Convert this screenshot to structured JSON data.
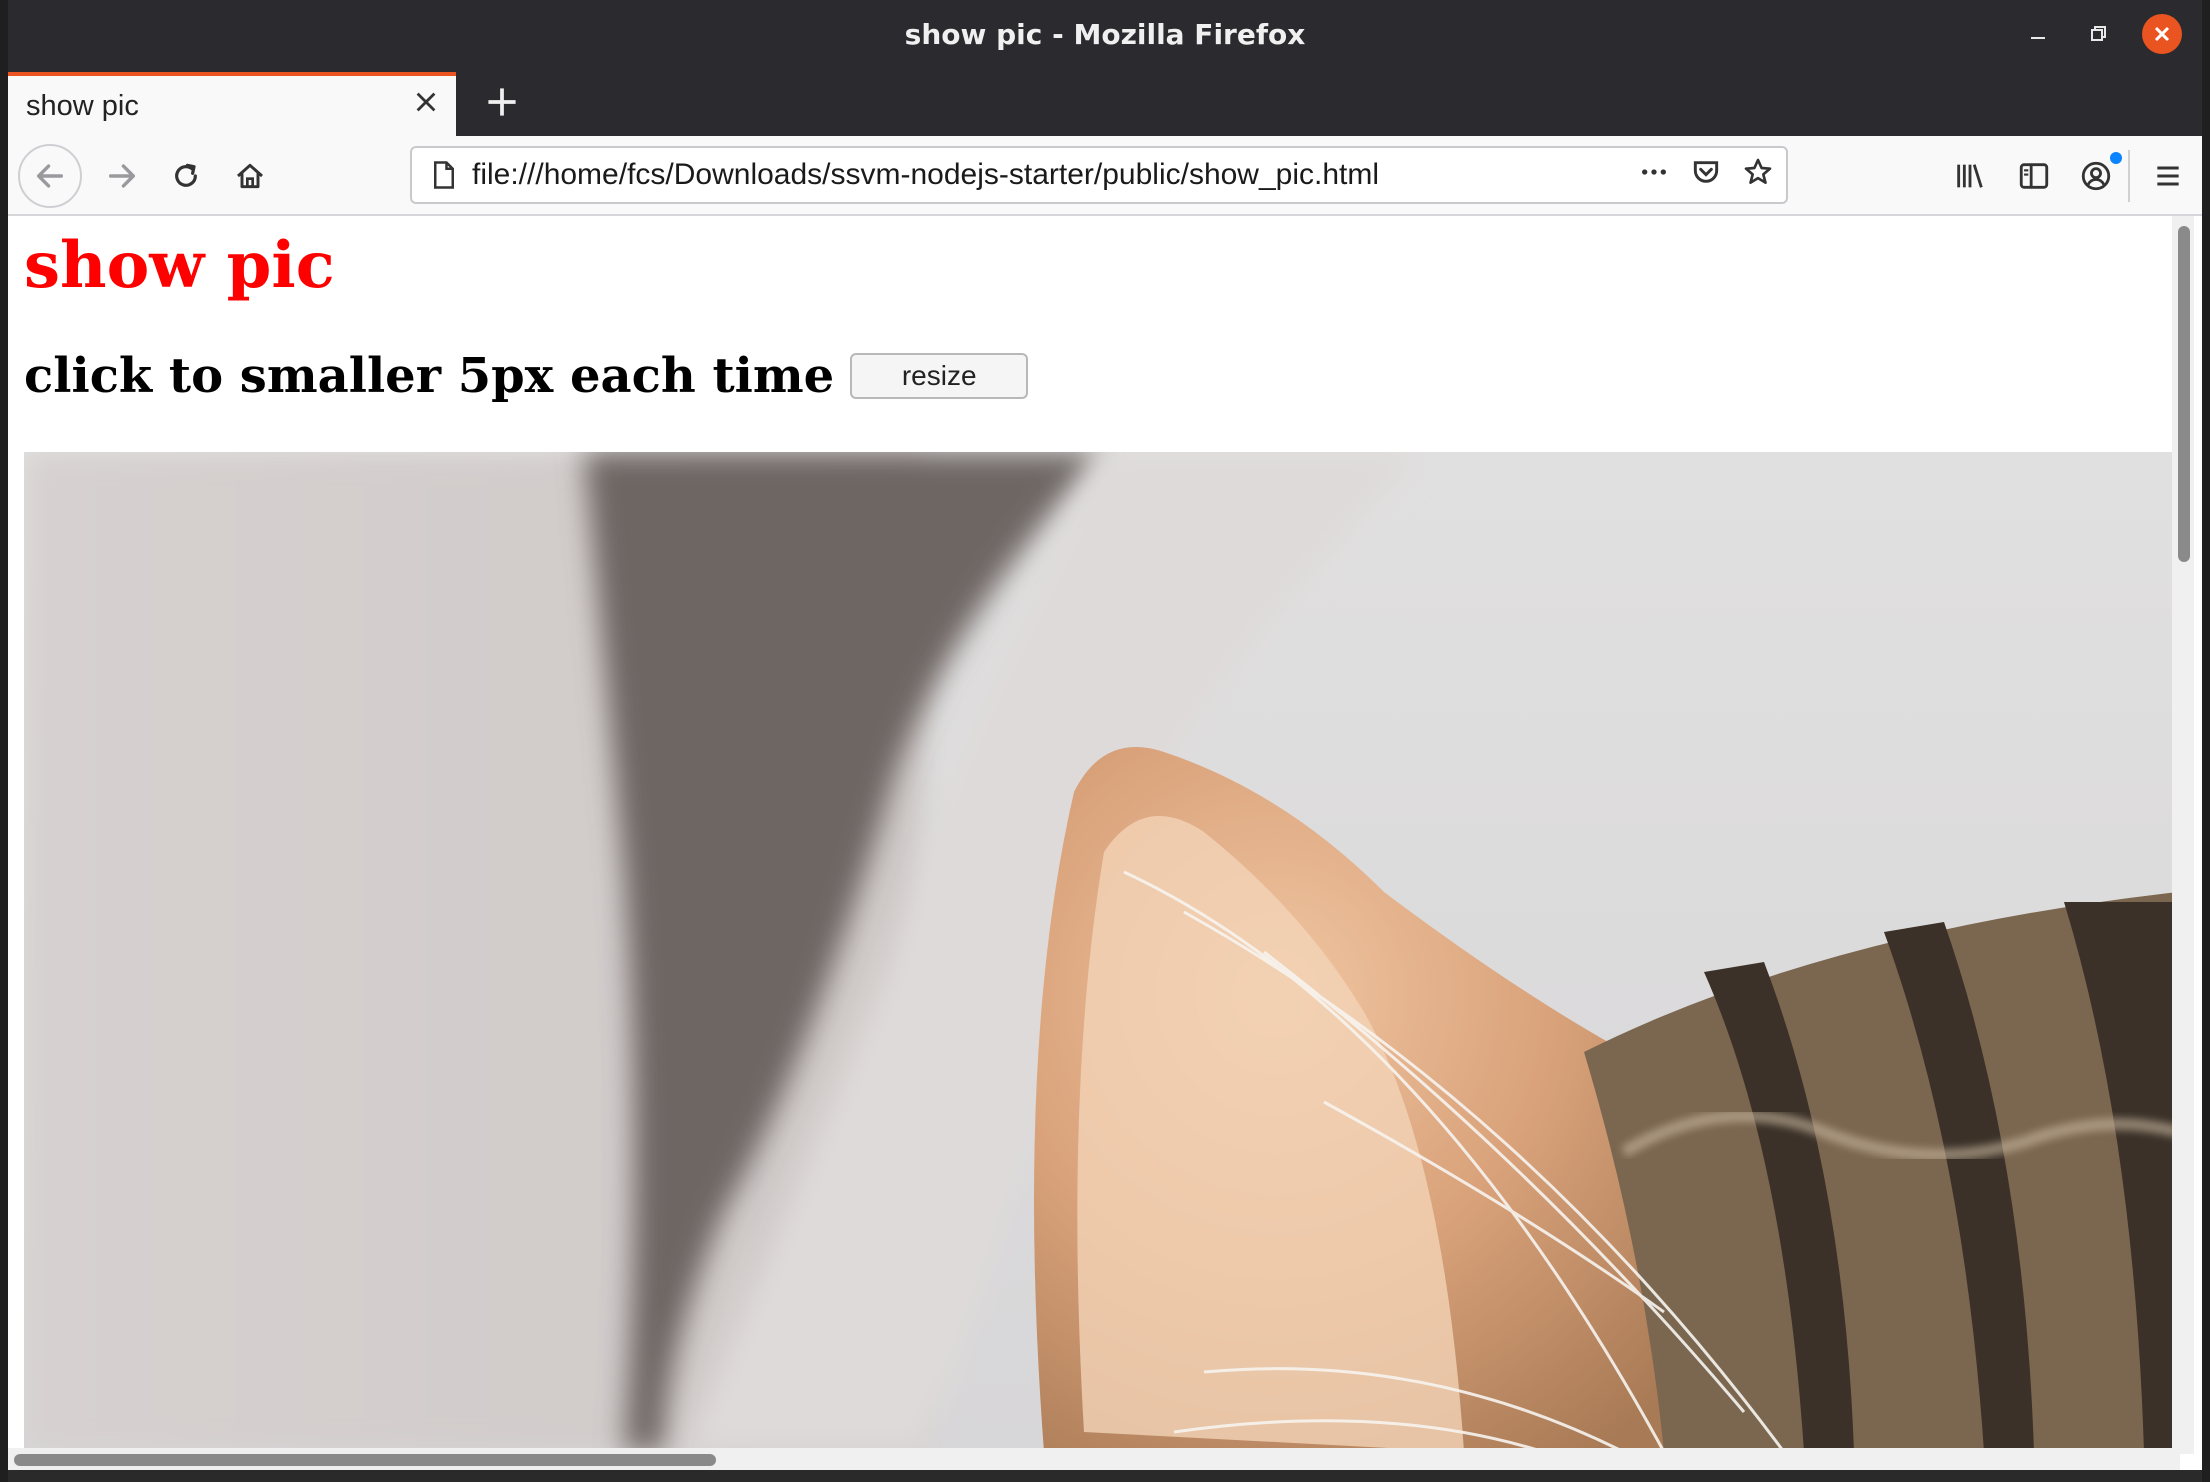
{
  "window": {
    "title": "show pic - Mozilla Firefox",
    "controls": {
      "minimize": "–",
      "maximize": "◻",
      "close": "✕"
    }
  },
  "tabs": [
    {
      "label": "show pic",
      "active": true
    }
  ],
  "nav": {
    "url": "file:///home/fcs/Downloads/ssvm-nodejs-starter/public/show_pic.html",
    "icons": [
      "back-icon",
      "forward-icon",
      "reload-icon",
      "home-icon",
      "page-icon",
      "more-icon",
      "pocket-icon",
      "bookmark-star-icon",
      "library-icon",
      "sidebar-icon",
      "account-icon",
      "menu-icon"
    ]
  },
  "page": {
    "title": "show pic",
    "subtitle": "click to smaller 5px each time",
    "resize_button": "resize",
    "image": {
      "subject": "cat-ear-photo"
    }
  },
  "colors": {
    "accent": "#e95420",
    "title_red": "#ff0000",
    "chrome_dark": "#2b2a2f"
  }
}
